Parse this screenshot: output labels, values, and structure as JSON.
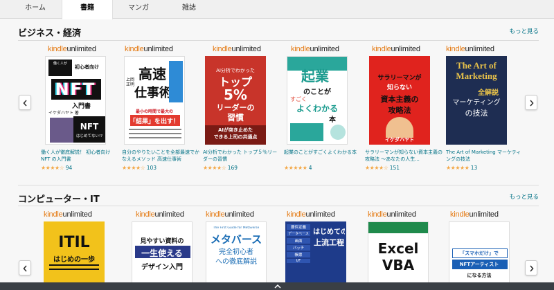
{
  "tabs": [
    {
      "label": "ホーム",
      "active": false
    },
    {
      "label": "書籍",
      "active": true
    },
    {
      "label": "マンガ",
      "active": false
    },
    {
      "label": "雑誌",
      "active": false
    }
  ],
  "kindle_unlimited": {
    "kindle": "kindle",
    "unlimited": "unlimited"
  },
  "sections": [
    {
      "title": "ビジネス・経済",
      "more": "もっと見る",
      "books": [
        {
          "title": "働く人が徹底解説！ 初心者向けNFT の入門書",
          "stars": "★★★★☆",
          "rating_count": "94",
          "cover": {
            "bg": "#ffffff",
            "lines": [
              "働く人が",
              "初心者向け",
              "NFT",
              "入門書",
              "イケダハヤト 著",
              "NFT",
              "はじめてない!?"
            ]
          }
        },
        {
          "title": "自分のやりたいことを全部最速でかなえるメソッド 高速仕事術",
          "stars": "★★★★☆",
          "rating_count": "103",
          "cover": {
            "bg": "#ffffff",
            "lines": [
              "上岡正明",
              "高速",
              "仕事術",
              "最小の時間で最大の",
              "「結果」を出す！"
            ]
          }
        },
        {
          "title": "AI分析でわかった トップ５％リーダーの習慣",
          "stars": "★★★★☆",
          "rating_count": "169",
          "cover": {
            "bg": "#c8342a",
            "lines": [
              "AI分析でわかった",
              "トップ",
              "5%",
              "リーダーの",
              "習慣",
              "AIが突き止めた",
              "できる上司の共通点"
            ]
          }
        },
        {
          "title": "起業のことがすごくよくわかる本",
          "stars": "★★★★★",
          "rating_count": "4",
          "cover": {
            "bg": "#ffffff",
            "lines": [
              "起業",
              "のことが",
              "すごく",
              "よくわかる",
              "本"
            ]
          }
        },
        {
          "title": "サラリーマンが知らない資本主義の攻略法 ～あなたの人生...",
          "stars": "★★★★☆",
          "rating_count": "151",
          "cover": {
            "bg": "#e0231e",
            "lines": [
              "サラリーマンが",
              "知らない",
              "資本主義の",
              "攻略法",
              "イケダハヤト"
            ]
          }
        },
        {
          "title": "The Art of Marketing マーケティングの技法",
          "stars": "★★★★★",
          "rating_count": "13",
          "cover": {
            "bg": "#1e2d52",
            "lines": [
              "The Art of",
              "Marketing",
              "マーケティング",
              "の技法",
              "全解説"
            ]
          }
        }
      ]
    },
    {
      "title": "コンピューター・IT",
      "more": "もっと見る",
      "books": [
        {
          "cover": {
            "bg": "#f2c21b",
            "lines": [
              "ITIL",
              "はじめの一歩"
            ]
          }
        },
        {
          "cover": {
            "bg": "#ffffff",
            "lines": [
              "見やすい資料の",
              "一生使える",
              "デザイン入門"
            ]
          }
        },
        {
          "cover": {
            "bg": "#ffffff",
            "lines": [
              "The First Guide for Metaverse",
              "メタバース",
              "完全初心者",
              "への徹底解説"
            ]
          }
        },
        {
          "cover": {
            "bg": "#1e3b8a",
            "lines": [
              "要件定義",
              "データベース",
              "画面",
              "バッチ",
              "帳票",
              "I/F",
              "はじめての",
              "上流工程"
            ]
          }
        },
        {
          "cover": {
            "bg": "#ffffff",
            "lines": [
              "Excel",
              "VBA"
            ]
          }
        },
        {
          "cover": {
            "bg": "#ffffff",
            "lines": [
              "「スマホだけ」で",
              "NFTアーティスト",
              "になる方法"
            ]
          }
        }
      ]
    }
  ]
}
